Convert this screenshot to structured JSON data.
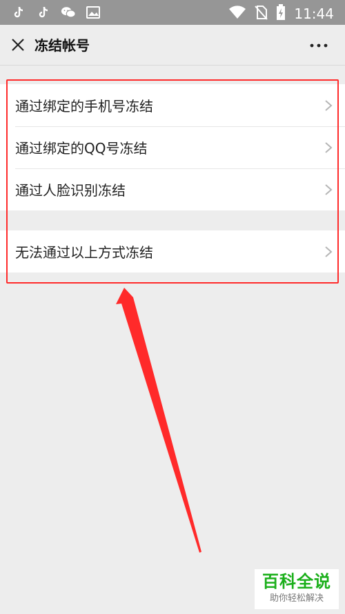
{
  "status_bar": {
    "time": "11:44",
    "left_icons": [
      "tiktok-icon",
      "tiktok-icon",
      "wechat-icon",
      "image-icon"
    ],
    "right_icons": [
      "wifi-icon",
      "no-sim-icon",
      "battery-charging-icon"
    ]
  },
  "header": {
    "title": "冻结帐号",
    "close_icon": "close-icon",
    "more_icon": "more-icon"
  },
  "options": {
    "group1": [
      {
        "label": "通过绑定的手机号冻结"
      },
      {
        "label": "通过绑定的QQ号冻结"
      },
      {
        "label": "通过人脸识别冻结"
      }
    ],
    "group2": [
      {
        "label": "无法通过以上方式冻结"
      }
    ]
  },
  "annotation": {
    "color": "#ff2a2a"
  },
  "watermark": {
    "main": "百科全说",
    "sub": "助你轻松解决",
    "color": "#1aaf1a"
  }
}
